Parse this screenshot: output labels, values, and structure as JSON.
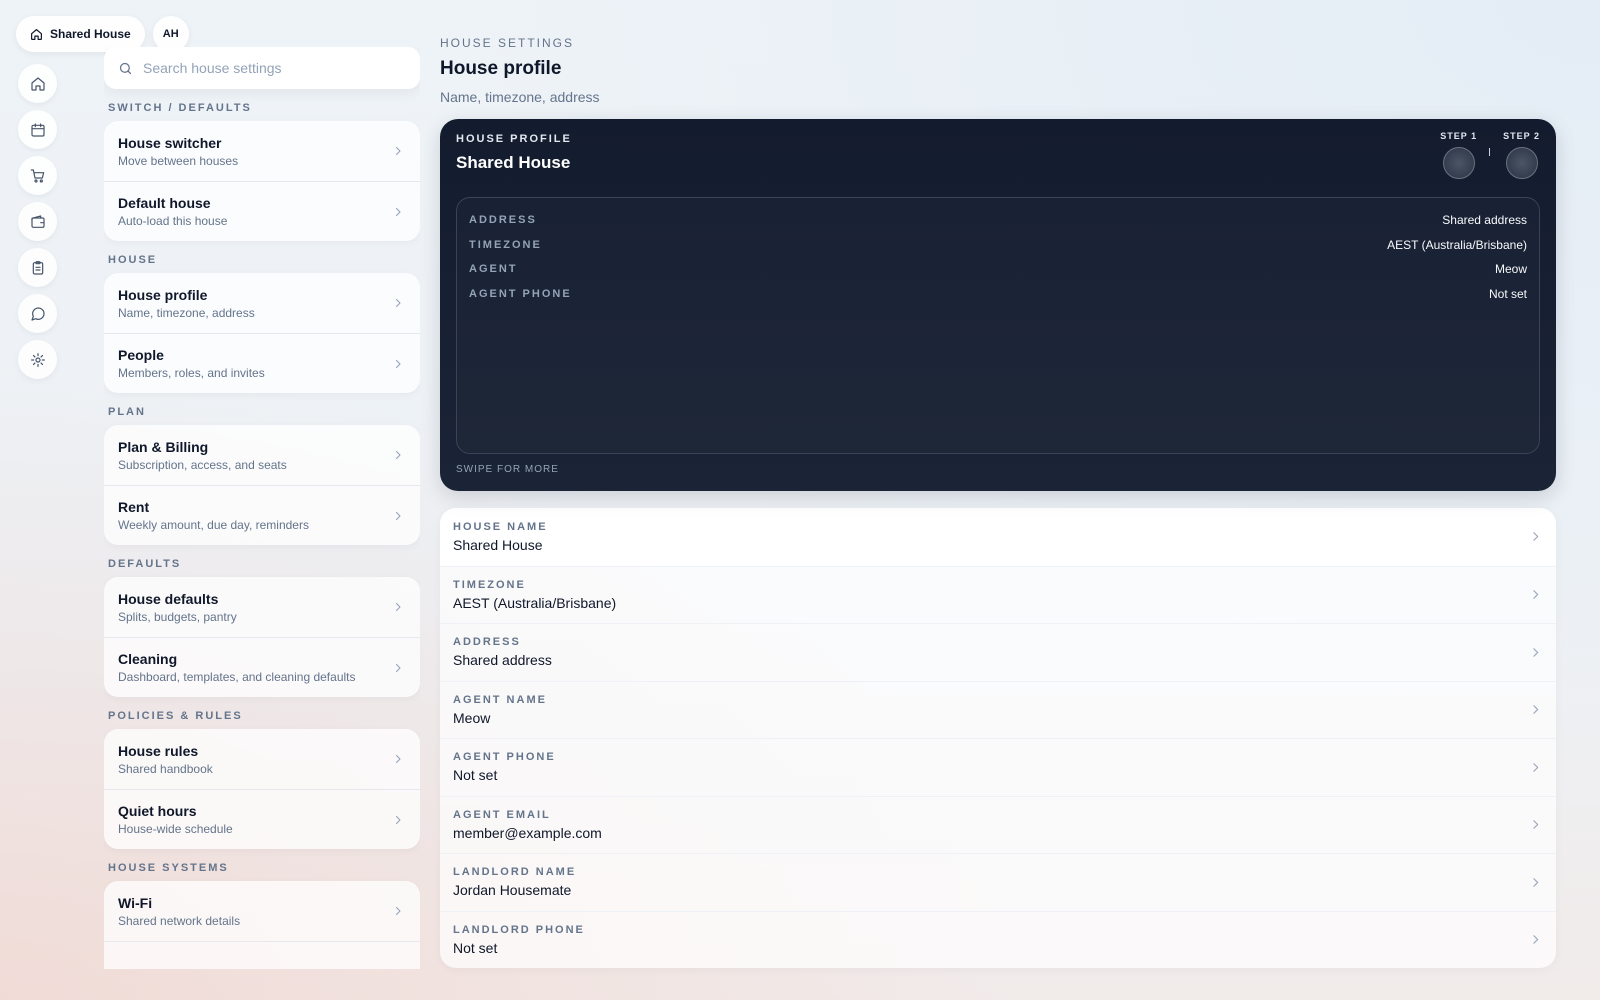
{
  "top": {
    "house_label": "Shared House",
    "avatar_initials": "AH"
  },
  "rail": [
    {
      "icon": "home-icon"
    },
    {
      "icon": "calendar-icon"
    },
    {
      "icon": "cart-icon"
    },
    {
      "icon": "wallet-icon"
    },
    {
      "icon": "clipboard-icon"
    },
    {
      "icon": "chat-icon"
    },
    {
      "icon": "gear-icon"
    }
  ],
  "sidebar": {
    "search_placeholder": "Search house settings",
    "sections": [
      {
        "label": "SWITCH / DEFAULTS",
        "items": [
          {
            "title": "House switcher",
            "sub": "Move between houses"
          },
          {
            "title": "Default house",
            "sub": "Auto-load this house"
          }
        ]
      },
      {
        "label": "HOUSE",
        "items": [
          {
            "title": "House profile",
            "sub": "Name, timezone, address"
          },
          {
            "title": "People",
            "sub": "Members, roles, and invites"
          }
        ]
      },
      {
        "label": "PLAN",
        "items": [
          {
            "title": "Plan & Billing",
            "sub": "Subscription, access, and seats"
          },
          {
            "title": "Rent",
            "sub": "Weekly amount, due day, reminders"
          }
        ]
      },
      {
        "label": "DEFAULTS",
        "items": [
          {
            "title": "House defaults",
            "sub": "Splits, budgets, pantry"
          },
          {
            "title": "Cleaning",
            "sub": "Dashboard, templates, and cleaning defaults"
          }
        ]
      },
      {
        "label": "POLICIES & RULES",
        "items": [
          {
            "title": "House rules",
            "sub": "Shared handbook"
          },
          {
            "title": "Quiet hours",
            "sub": "House-wide schedule"
          }
        ]
      },
      {
        "label": "HOUSE SYSTEMS",
        "items": [
          {
            "title": "Wi-Fi",
            "sub": "Shared network details"
          }
        ]
      }
    ]
  },
  "main": {
    "eyebrow": "HOUSE SETTINGS",
    "title": "House profile",
    "subtitle": "Name, timezone, address",
    "card": {
      "eyebrow": "HOUSE PROFILE",
      "title": "Shared House",
      "step1": "STEP 1",
      "step2": "STEP 2",
      "rows": [
        {
          "k": "ADDRESS",
          "v": "Shared address"
        },
        {
          "k": "TIMEZONE",
          "v": "AEST (Australia/Brisbane)"
        },
        {
          "k": "AGENT",
          "v": "Meow"
        },
        {
          "k": "AGENT PHONE",
          "v": "Not set"
        }
      ],
      "swipe": "SWIPE FOR MORE"
    },
    "fields": [
      {
        "label": "HOUSE NAME",
        "value": "Shared House"
      },
      {
        "label": "TIMEZONE",
        "value": "AEST (Australia/Brisbane)"
      },
      {
        "label": "ADDRESS",
        "value": "Shared address"
      },
      {
        "label": "AGENT NAME",
        "value": "Meow"
      },
      {
        "label": "AGENT PHONE",
        "value": "Not set"
      },
      {
        "label": "AGENT EMAIL",
        "value": "member@example.com"
      },
      {
        "label": "LANDLORD NAME",
        "value": "Jordan Housemate"
      },
      {
        "label": "LANDLORD PHONE",
        "value": "Not set"
      }
    ]
  }
}
